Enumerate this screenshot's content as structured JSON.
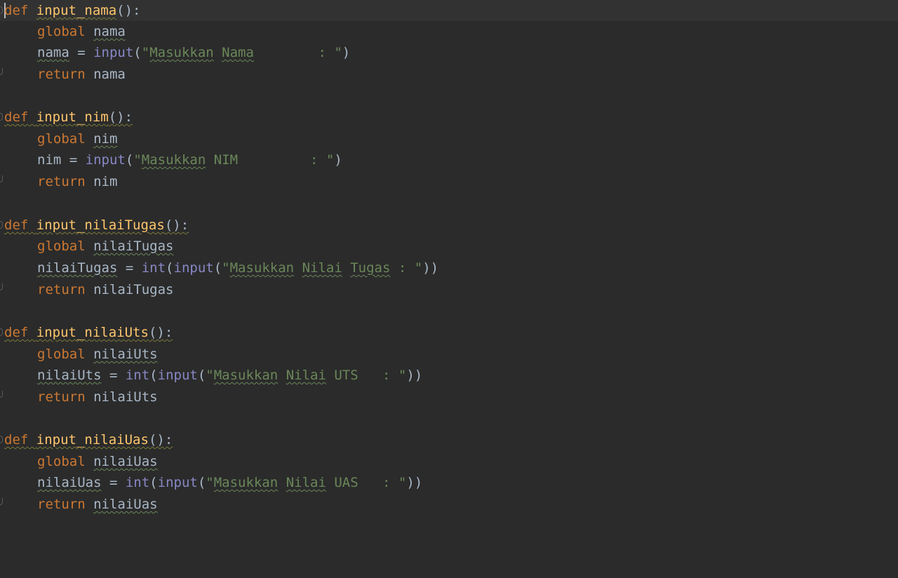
{
  "editor": {
    "language": "python",
    "colors": {
      "background": "#2b2b2b",
      "current_line": "#323232",
      "keyword": "#cc7832",
      "function": "#ffc66d",
      "builtin": "#8888c6",
      "string": "#6a8759",
      "text": "#a9b7c6"
    },
    "tok": {
      "def": "def",
      "global": "global",
      "return": "return",
      "input": "input",
      "int": "int",
      "eq": " = ",
      "paren_open": "(",
      "paren_close": ")",
      "def_end": "():",
      "q": "\"",
      "space": " "
    },
    "functions": {
      "f1": {
        "name": "input_nama",
        "var": "nama",
        "prompt_word1": "Masukkan",
        "prompt_word2": "Nama",
        "prompt_tail": "        : ",
        "call_close": ")"
      },
      "f2": {
        "name": "input_nim",
        "var": "nim",
        "prompt_word1": "Masukkan",
        "prompt_tail": " NIM         : ",
        "call_close": ")"
      },
      "f3": {
        "name": "input_nilaiTugas",
        "var": "nilaiTugas",
        "prompt_word1": "Masukkan",
        "prompt_word2": "Nilai",
        "prompt_word3": "Tugas",
        "prompt_tail": " : ",
        "call_close": "))"
      },
      "f4": {
        "name": "input_nilaiUts",
        "var": "nilaiUts",
        "prompt_word1": "Masukkan",
        "prompt_word2": "Nilai",
        "prompt_tail": " UTS   : ",
        "call_close": "))"
      },
      "f5": {
        "name": "input_nilaiUas",
        "var": "nilaiUas",
        "prompt_word1": "Masukkan",
        "prompt_word2": "Nilai",
        "prompt_tail": " UAS   : ",
        "call_close": "))"
      }
    }
  }
}
